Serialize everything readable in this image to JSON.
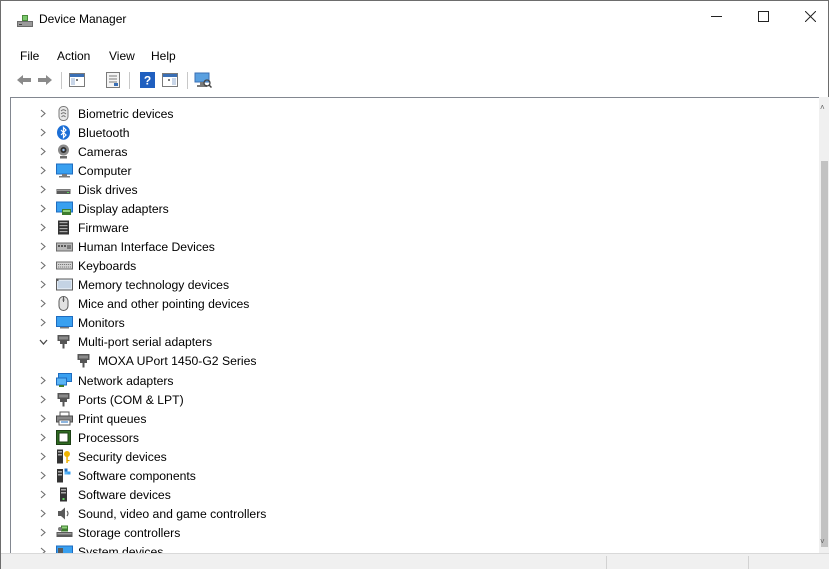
{
  "window": {
    "title": "Device Manager",
    "minimize_glyph": "—",
    "maximize_glyph": "☐",
    "close_glyph": "✕"
  },
  "menu": [
    "File",
    "Action",
    "View",
    "Help"
  ],
  "toolbar": [
    "back-icon",
    "forward-icon",
    "show-hide-console-tree-icon",
    "properties-icon",
    "help-icon",
    "show-hide-action-pane-icon",
    "scan-hardware-icon"
  ],
  "tree": {
    "items": [
      {
        "label": "Biometric devices",
        "icon": "fingerprint-icon",
        "expanded": false
      },
      {
        "label": "Bluetooth",
        "icon": "bluetooth-icon",
        "expanded": false
      },
      {
        "label": "Cameras",
        "icon": "camera-icon",
        "expanded": false
      },
      {
        "label": "Computer",
        "icon": "computer-icon",
        "expanded": false
      },
      {
        "label": "Disk drives",
        "icon": "disk-drive-icon",
        "expanded": false
      },
      {
        "label": "Display adapters",
        "icon": "display-adapter-icon",
        "expanded": false
      },
      {
        "label": "Firmware",
        "icon": "firmware-icon",
        "expanded": false
      },
      {
        "label": "Human Interface Devices",
        "icon": "hid-icon",
        "expanded": false
      },
      {
        "label": "Keyboards",
        "icon": "keyboard-icon",
        "expanded": false
      },
      {
        "label": "Memory technology devices",
        "icon": "memory-card-icon",
        "expanded": false
      },
      {
        "label": "Mice and other pointing devices",
        "icon": "mouse-icon",
        "expanded": false
      },
      {
        "label": "Monitors",
        "icon": "monitor-icon",
        "expanded": false
      },
      {
        "label": "Multi-port serial adapters",
        "icon": "serial-port-icon",
        "expanded": true,
        "children": [
          "MOXA UPort 1450-G2 Series"
        ]
      },
      {
        "label": "Network adapters",
        "icon": "network-adapter-icon",
        "expanded": false
      },
      {
        "label": "Ports (COM & LPT)",
        "icon": "port-icon",
        "expanded": false
      },
      {
        "label": "Print queues",
        "icon": "printer-icon",
        "expanded": false
      },
      {
        "label": "Processors",
        "icon": "processor-icon",
        "expanded": false
      },
      {
        "label": "Security devices",
        "icon": "security-key-icon",
        "expanded": false
      },
      {
        "label": "Software components",
        "icon": "software-component-icon",
        "expanded": false
      },
      {
        "label": "Software devices",
        "icon": "software-device-icon",
        "expanded": false
      },
      {
        "label": "Sound, video and game controllers",
        "icon": "speaker-icon",
        "expanded": false
      },
      {
        "label": "Storage controllers",
        "icon": "storage-controller-icon",
        "expanded": false
      },
      {
        "label": "System devices",
        "icon": "system-device-icon",
        "expanded": false
      }
    ]
  },
  "scrollbar": {
    "up_glyph": "˄",
    "down_glyph": "˅"
  }
}
